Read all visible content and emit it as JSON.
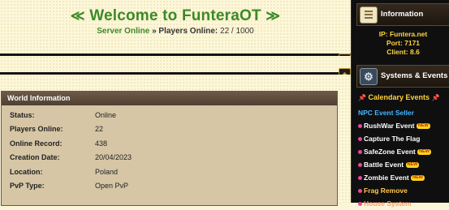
{
  "welcome": {
    "title": "Welcome to FunteraOT",
    "ornament_left": "≪",
    "ornament_right": "≫",
    "server_status": "Server Online",
    "separator": " » ",
    "players_label": "Players Online:",
    "players_value": "22 / 1000"
  },
  "world_info": {
    "title": "World Information",
    "rows": [
      {
        "label": "Status:",
        "value": "Online"
      },
      {
        "label": "Players Online:",
        "value": "22"
      },
      {
        "label": "Online Record:",
        "value": "438"
      },
      {
        "label": "Creation Date:",
        "value": "20/04/2023"
      },
      {
        "label": "Location:",
        "value": "Poland"
      },
      {
        "label": "PvP Type:",
        "value": "Open PvP"
      }
    ]
  },
  "sidebar": {
    "information_title": "Information",
    "ip": "IP: Funtera.net",
    "port": "Port: 7171",
    "client": "Client: 8.6",
    "systems_title": "Systems & Events",
    "calendar_title": "Calendary Events",
    "new_badge": "NEW",
    "events": [
      {
        "label": "NPC Event Seller"
      },
      {
        "label": "RushWar Event"
      },
      {
        "label": "Capture The Flag"
      },
      {
        "label": "SafeZone Event"
      },
      {
        "label": "Battle Event"
      },
      {
        "label": "Zombie Event"
      },
      {
        "label": "Frag Remove"
      },
      {
        "label": "House System"
      }
    ]
  },
  "colors": {
    "accent_green": "#3c8a26",
    "gold": "#ffd33d",
    "link_blue": "#46b6ff",
    "panel_brown": "#6e5a48"
  },
  "icons": {
    "information": "scroll-icon",
    "systems": "gear-icon",
    "calendar": "pin-icon",
    "bullet": "dot-icon",
    "corner": "corner-ornament-icon"
  }
}
